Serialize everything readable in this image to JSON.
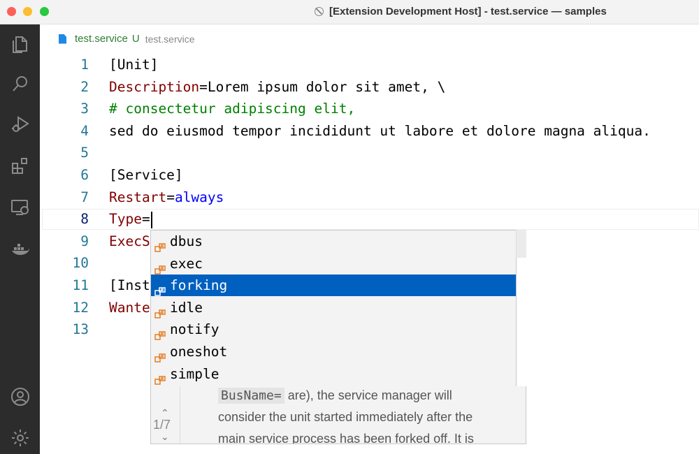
{
  "window": {
    "title": "[Extension Development Host] - test.service — samples"
  },
  "activity_bar": {
    "top_icons": [
      "files-icon",
      "search-icon",
      "run-debug-icon",
      "extensions-icon",
      "remote-explorer-icon",
      "docker-icon"
    ],
    "bottom_icons": [
      "account-icon",
      "settings-gear-icon"
    ]
  },
  "tab": {
    "filename": "test.service",
    "status": "U",
    "path": "test.service"
  },
  "editor": {
    "active_line": 8,
    "lines": [
      {
        "no": "1",
        "segments": [
          {
            "t": "[Unit]",
            "c": ""
          }
        ]
      },
      {
        "no": "2",
        "segments": [
          {
            "t": "Description",
            "c": "key"
          },
          {
            "t": "=Lorem ipsum dolor sit amet, \\",
            "c": ""
          }
        ]
      },
      {
        "no": "3",
        "segments": [
          {
            "t": "# consectetur adipiscing elit,",
            "c": "comment"
          }
        ]
      },
      {
        "no": "4",
        "segments": [
          {
            "t": "sed do eiusmod tempor incididunt ut labore et dolore magna aliqua.",
            "c": ""
          }
        ]
      },
      {
        "no": "5",
        "segments": []
      },
      {
        "no": "6",
        "segments": [
          {
            "t": "[Service]",
            "c": ""
          }
        ]
      },
      {
        "no": "7",
        "segments": [
          {
            "t": "Restart",
            "c": "key"
          },
          {
            "t": "=",
            "c": ""
          },
          {
            "t": "always",
            "c": "val"
          }
        ]
      },
      {
        "no": "8",
        "segments": [
          {
            "t": "Type",
            "c": "key"
          },
          {
            "t": "=",
            "c": ""
          }
        ]
      },
      {
        "no": "9",
        "segments": [
          {
            "t": "ExecS",
            "c": "key"
          }
        ]
      },
      {
        "no": "10",
        "segments": []
      },
      {
        "no": "11",
        "segments": [
          {
            "t": "[Inst",
            "c": ""
          }
        ]
      },
      {
        "no": "12",
        "segments": [
          {
            "t": "Wante",
            "c": "key"
          }
        ]
      },
      {
        "no": "13",
        "segments": []
      }
    ]
  },
  "suggest": {
    "selected_index": 2,
    "items": [
      "dbus",
      "exec",
      "forking",
      "idle",
      "notify",
      "oneshot",
      "simple"
    ],
    "icon_color": "#e67e22",
    "selected_bg": "#0060c0"
  },
  "details": {
    "count": "1/7",
    "chip": "BusName=",
    "text_after_chip": " are), the service manager will",
    "line2": "consider the unit started immediately after the",
    "line3": "main service process has been forked off. It is"
  }
}
